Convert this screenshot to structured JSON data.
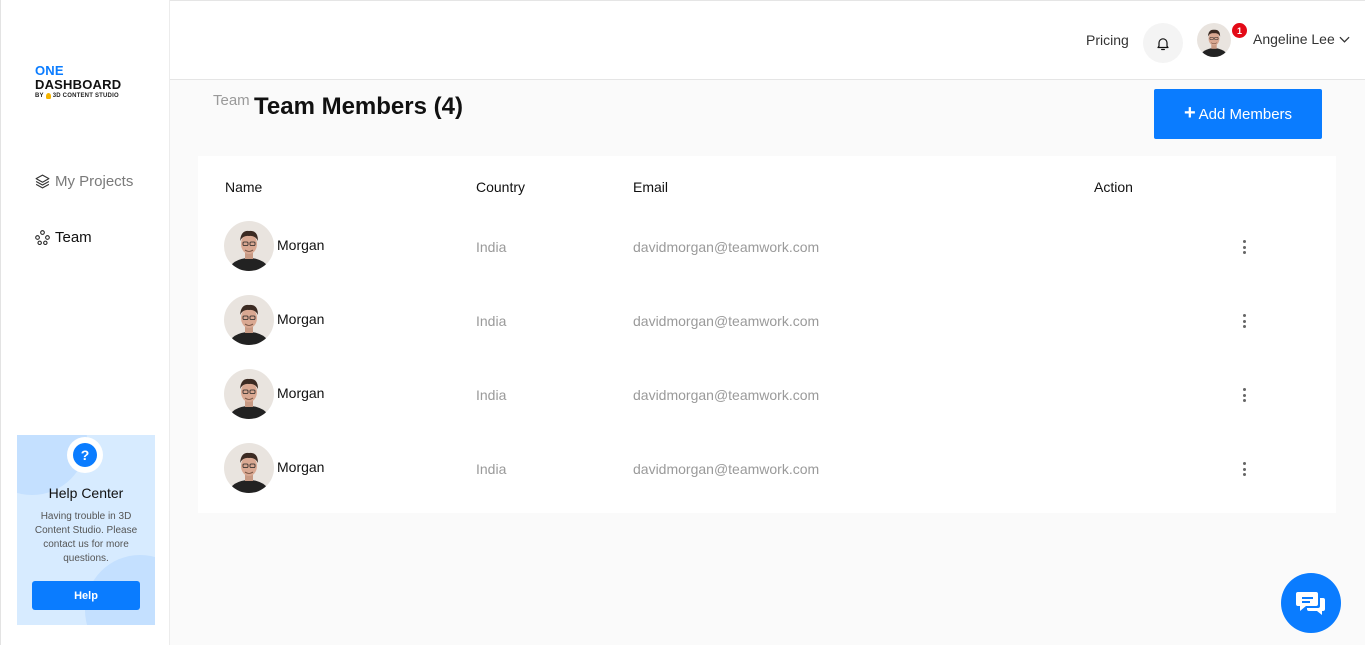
{
  "logo": {
    "line1": "ONE",
    "line2": "DASHBOARD",
    "tagline_prefix": "BY",
    "tagline": "3D CONTENT STUDIO"
  },
  "sidebar": {
    "items": [
      {
        "label": "My Projects",
        "icon": "layers-icon"
      },
      {
        "label": "Team",
        "icon": "team-icon"
      }
    ]
  },
  "help_center": {
    "icon": "?",
    "title": "Help Center",
    "text": "Having trouble in 3D Content Studio. Please contact us for more questions.",
    "button": "Help"
  },
  "header": {
    "pricing": "Pricing",
    "notification_count": "1",
    "user_name": "Angeline Lee"
  },
  "page": {
    "breadcrumb": "Team",
    "title": "Team Members (4)",
    "add_button": "Add Members"
  },
  "table": {
    "columns": [
      "Name",
      "Country",
      "Email",
      "Action"
    ],
    "rows": [
      {
        "name": "Morgan",
        "country": "India",
        "email": "davidmorgan@teamwork.com"
      },
      {
        "name": "Morgan",
        "country": "India",
        "email": "davidmorgan@teamwork.com"
      },
      {
        "name": "Morgan",
        "country": "India",
        "email": "davidmorgan@teamwork.com"
      },
      {
        "name": "Morgan",
        "country": "India",
        "email": "davidmorgan@teamwork.com"
      }
    ]
  },
  "colors": {
    "accent": "#0a7cff",
    "badge": "#e30a17"
  }
}
